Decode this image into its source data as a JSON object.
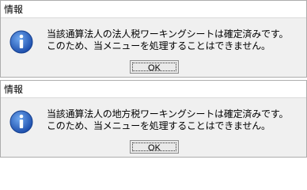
{
  "dialogs": [
    {
      "title": "情報",
      "icon": "info-icon",
      "message_line1": "当該通算法人の法人税ワーキングシートは確定済みです。",
      "message_line2": "このため、当メニューを処理することはできません。",
      "ok_label": "OK"
    },
    {
      "title": "情報",
      "icon": "info-icon",
      "message_line1": "当該通算法人の地方税ワーキングシートは確定済みです。",
      "message_line2": "このため、当メニューを処理することはできません。",
      "ok_label": "OK"
    }
  ],
  "colors": {
    "icon_blue": "#1f5fbf",
    "dialog_bg": "#f0f0f0"
  }
}
